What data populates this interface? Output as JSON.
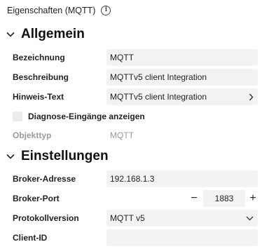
{
  "panel": {
    "title": "Eigenschaften (MQTT)"
  },
  "sections": {
    "general": {
      "label": "Allgemein"
    },
    "settings": {
      "label": "Einstellungen"
    }
  },
  "general": {
    "name": {
      "label": "Bezeichnung",
      "value": "MQTT"
    },
    "description": {
      "label": "Beschreibung",
      "value": "MQTTv5 client Integration"
    },
    "hint": {
      "label": "Hinweis-Text",
      "value": "MQTTv5 client Integration"
    },
    "diagnostics": {
      "label": "Diagnose-Eingänge anzeigen",
      "checked": false
    },
    "object_type": {
      "label": "Objekttyp",
      "value": "MQTT"
    }
  },
  "settings": {
    "broker_address": {
      "label": "Broker-Adresse",
      "value": "192.168.1.3"
    },
    "broker_port": {
      "label": "Broker-Port",
      "value": "1883",
      "minus": "−",
      "plus": "+"
    },
    "protocol": {
      "label": "Protokollversion",
      "value": "MQTT v5"
    },
    "client_id": {
      "label": "Client-ID",
      "value": ""
    }
  },
  "icons": {
    "info": "info-icon",
    "section_collapse": "chevron-down-icon",
    "hint_open": "chevron-right-icon",
    "dropdown": "chevron-down-icon"
  }
}
